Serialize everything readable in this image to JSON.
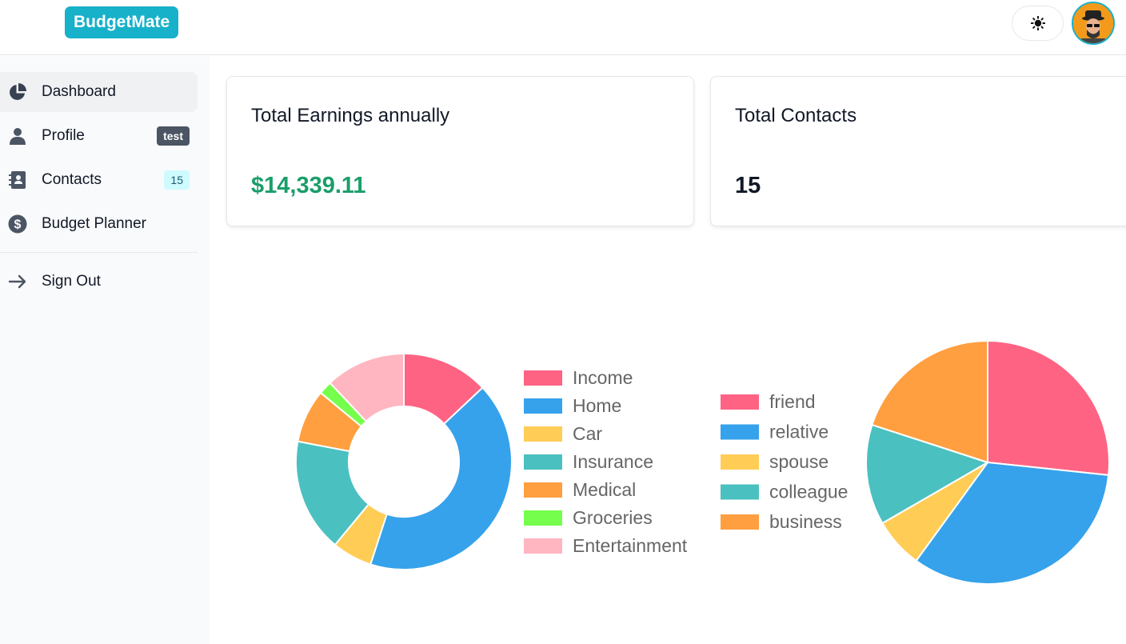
{
  "header": {
    "logo_text": "BudgetMate",
    "theme_icon": "sun-icon",
    "avatar_icon": "user-avatar"
  },
  "sidebar": {
    "items": [
      {
        "label": "Dashboard",
        "icon": "pie-chart-icon",
        "active": true
      },
      {
        "label": "Profile",
        "icon": "user-icon",
        "badge": "test"
      },
      {
        "label": "Contacts",
        "icon": "address-book-icon",
        "badge": "15"
      },
      {
        "label": "Budget Planner",
        "icon": "dollar-circle-icon"
      }
    ],
    "sign_out": {
      "label": "Sign Out",
      "icon": "arrow-right-icon"
    }
  },
  "cards": [
    {
      "title": "Total Earnings annually",
      "value": "$14,339.11",
      "value_color": "#1a9e6a"
    },
    {
      "title": "Total Contacts",
      "value": "15",
      "value_color": "#111827"
    }
  ],
  "chart_data": [
    {
      "type": "pie",
      "variant": "doughnut",
      "legend_position": "right",
      "categories": [
        "Income",
        "Home",
        "Car",
        "Insurance",
        "Medical",
        "Groceries",
        "Entertainment"
      ],
      "values": [
        13,
        42,
        6,
        17,
        8,
        2,
        12
      ],
      "colors": [
        "#ff6384",
        "#36a2eb",
        "#ffcd56",
        "#4bc0c0",
        "#ff9f40",
        "#75ff4c",
        "#ffb6c1"
      ]
    },
    {
      "type": "pie",
      "legend_position": "left",
      "categories": [
        "friend",
        "relative",
        "spouse",
        "colleague",
        "business"
      ],
      "values": [
        4,
        5,
        1,
        2,
        3
      ],
      "colors": [
        "#ff6384",
        "#36a2eb",
        "#ffcd56",
        "#4bc0c0",
        "#ff9f40"
      ]
    }
  ]
}
